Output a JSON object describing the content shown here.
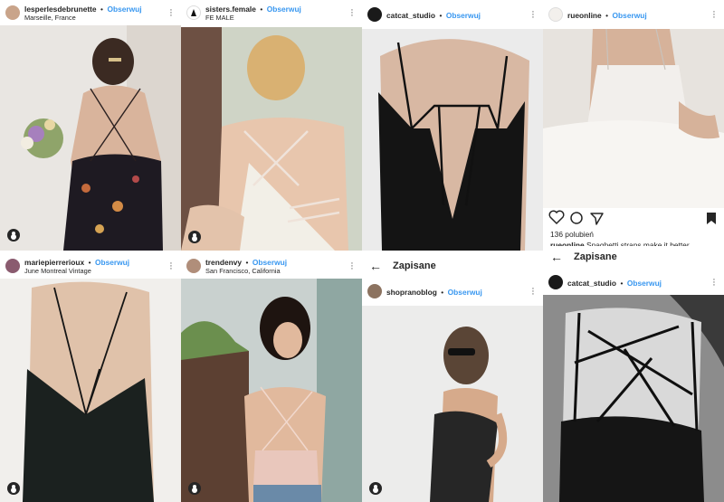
{
  "follow_label": "Obserwuj",
  "separator": "•",
  "posts": [
    {
      "username": "lesperlesdebrunette",
      "location": "Marseille, France"
    },
    {
      "username": "sisters.female",
      "location": "FE MALE"
    },
    {
      "username": "catcat_studio",
      "location": ""
    },
    {
      "username": "rueonline",
      "location": ""
    },
    {
      "username": "mariepierrerioux",
      "location": "June Montreal Vintage"
    },
    {
      "username": "trendenvy",
      "location": "San Francisco, California"
    },
    {
      "username": "shopranoblog",
      "location": ""
    },
    {
      "username": "catcat_studio",
      "location": ""
    }
  ],
  "saved_bar": {
    "title": "Zapisane"
  },
  "rueonline_post": {
    "likes": "136 polubień",
    "caption_user": "rueonline",
    "caption_text": "Spaghetti straps make it better"
  },
  "colors": {
    "follow": "#3897f0",
    "text": "#262626"
  }
}
